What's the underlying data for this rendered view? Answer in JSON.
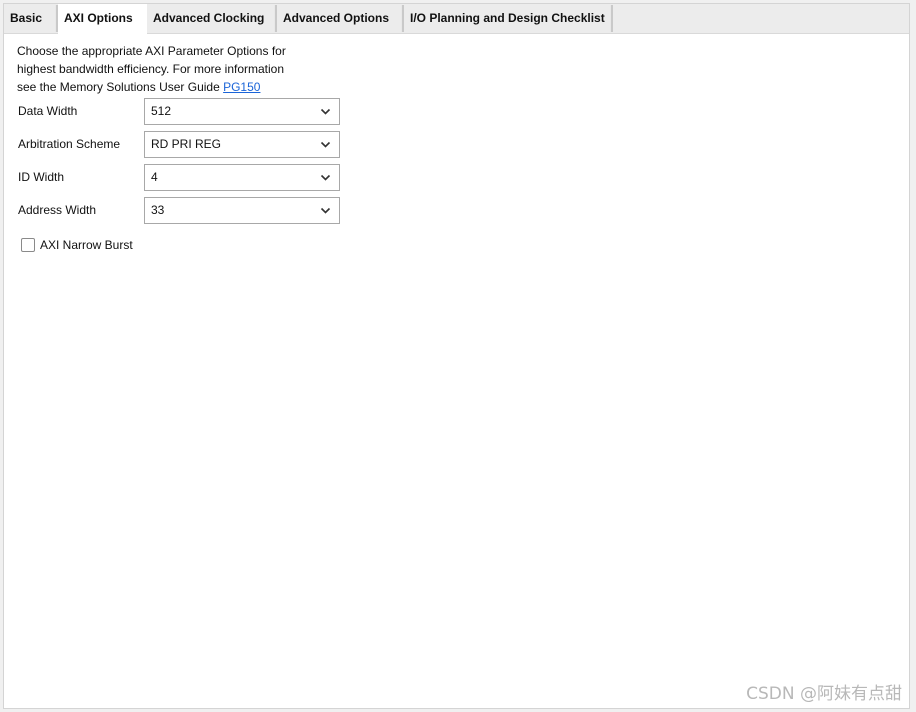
{
  "tabs": [
    {
      "label": "Basic",
      "active": false
    },
    {
      "label": "AXI Options",
      "active": true
    },
    {
      "label": "Advanced Clocking",
      "active": false
    },
    {
      "label": "Advanced Options",
      "active": false
    },
    {
      "label": "I/O Planning and Design Checklist",
      "active": false
    }
  ],
  "description": {
    "line1": "Choose the appropriate AXI Parameter Options for",
    "line2": "highest bandwidth efficiency. For more information",
    "line3_prefix": "see the Memory Solutions User Guide ",
    "link_text": "PG150"
  },
  "fields": {
    "data_width": {
      "label": "Data Width",
      "value": "512"
    },
    "arbitration_scheme": {
      "label": "Arbitration Scheme",
      "value": "RD PRI REG"
    },
    "id_width": {
      "label": "ID Width",
      "value": "4"
    },
    "address_width": {
      "label": "Address Width",
      "value": "33"
    }
  },
  "axi_narrow_burst": {
    "label": "AXI Narrow Burst",
    "checked": false
  },
  "watermark": "CSDN @阿妹有点甜",
  "colors": {
    "link": "#1a64d8",
    "active_tab_bg": "#ffffff",
    "tabbar_bg": "#ececec"
  }
}
